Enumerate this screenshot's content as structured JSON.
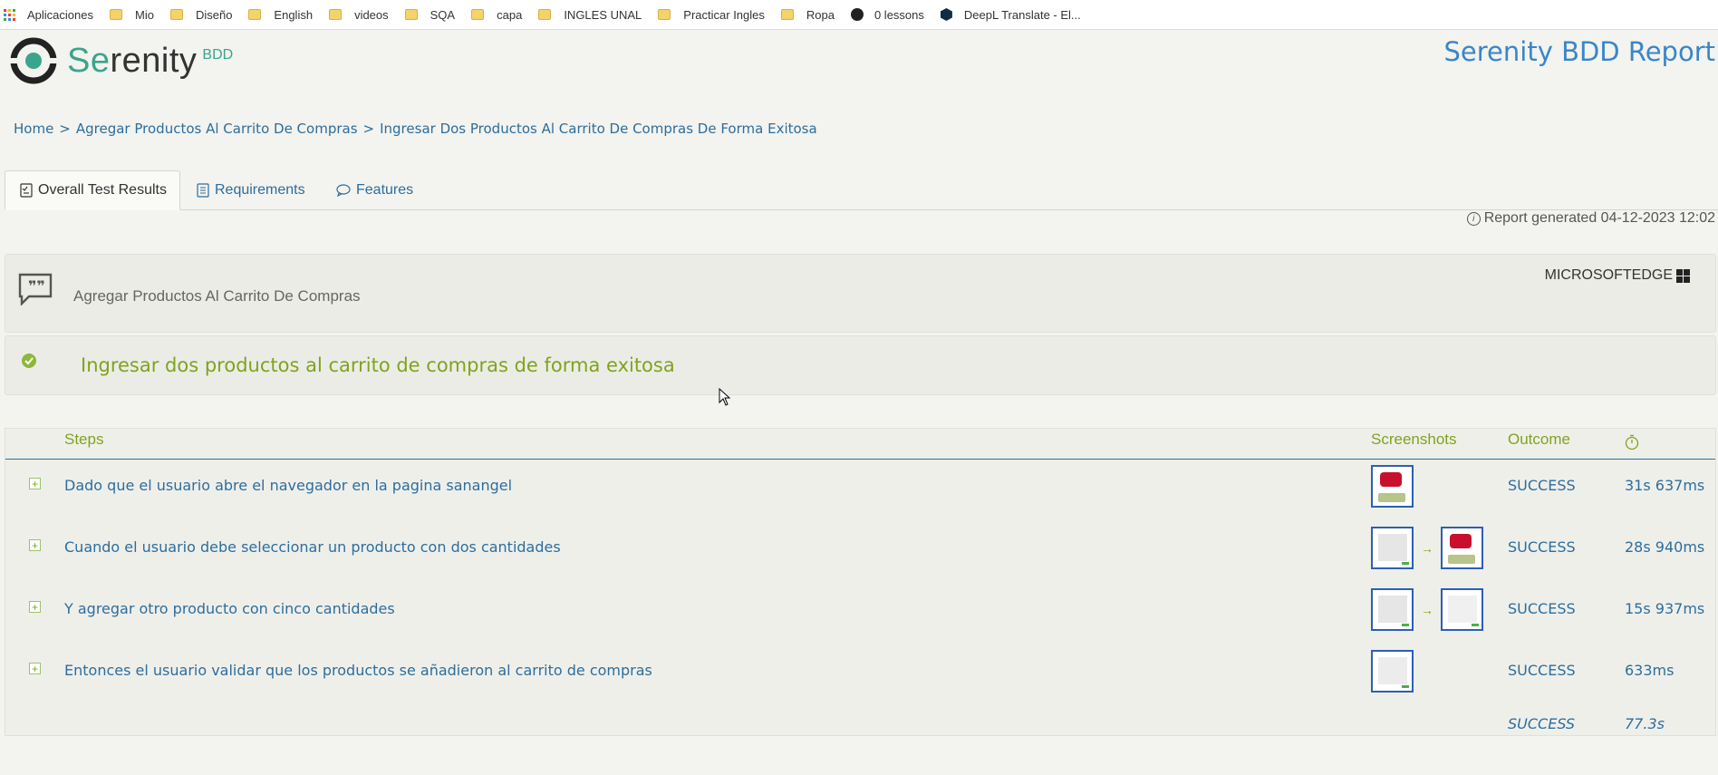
{
  "bookmarks": [
    {
      "label": "Aplicaciones",
      "icon": "apps-icon"
    },
    {
      "label": "Mio",
      "icon": "folder-icon"
    },
    {
      "label": "Diseño",
      "icon": "folder-icon"
    },
    {
      "label": "English",
      "icon": "folder-icon"
    },
    {
      "label": "videos",
      "icon": "folder-icon"
    },
    {
      "label": "SQA",
      "icon": "folder-icon"
    },
    {
      "label": "capa",
      "icon": "folder-icon"
    },
    {
      "label": "INGLES UNAL",
      "icon": "folder-icon"
    },
    {
      "label": "Practicar Ingles",
      "icon": "folder-icon"
    },
    {
      "label": "Ropa",
      "icon": "folder-icon"
    },
    {
      "label": "0 lessons",
      "icon": "globe-icon"
    },
    {
      "label": "DeepL Translate - El...",
      "icon": "deepl-icon"
    }
  ],
  "header": {
    "logo_se": "Se",
    "logo_rest": "renity",
    "logo_bdd": "BDD",
    "report_title": "Serenity BDD Report"
  },
  "breadcrumb": {
    "home": "Home",
    "sep": ">",
    "feature": "Agregar Productos Al Carrito De Compras",
    "scenario": "Ingresar Dos Productos Al Carrito De Compras De Forma Exitosa"
  },
  "tabs": [
    {
      "label": "Overall Test Results",
      "active": true
    },
    {
      "label": "Requirements",
      "active": false
    },
    {
      "label": "Features",
      "active": false
    }
  ],
  "generated": "Report generated 04-12-2023 12:02",
  "feature": {
    "name": "Agregar Productos Al Carrito De Compras",
    "browser": "MICROSOFTEDGE"
  },
  "scenario": {
    "title": "Ingresar dos productos al carrito de compras de forma exitosa",
    "status": "success"
  },
  "steps_table": {
    "headers": {
      "steps": "Steps",
      "screenshots": "Screenshots",
      "outcome": "Outcome",
      "duration_icon": "stopwatch-icon"
    },
    "rows": [
      {
        "description": "Dado que el usuario abre el navegador en la pagina sanangel",
        "outcome": "SUCCESS",
        "duration": "31s 637ms"
      },
      {
        "description": "Cuando el usuario debe seleccionar un producto con dos cantidades",
        "outcome": "SUCCESS",
        "duration": "28s 940ms"
      },
      {
        "description": "Y agregar otro producto con cinco cantidades",
        "outcome": "SUCCESS",
        "duration": "15s 937ms"
      },
      {
        "description": "Entonces el usuario validar que los productos se añadieron al carrito de compras",
        "outcome": "SUCCESS",
        "duration": "633ms"
      }
    ],
    "total": {
      "outcome": "SUCCESS",
      "duration": "77.3s"
    },
    "expand_symbol": "+",
    "arrow_symbol": "→"
  },
  "colors": {
    "accent": "#7fa31e",
    "link": "#2c6e9e",
    "title": "#3a86c8",
    "brand": "#3aa58c"
  }
}
